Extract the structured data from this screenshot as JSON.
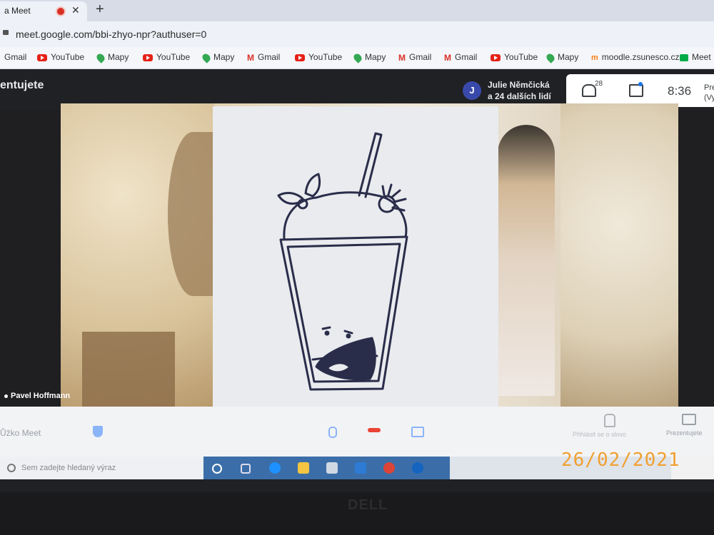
{
  "browser": {
    "tab_title": "a Meet",
    "tab_close": "✕",
    "new_tab": "+",
    "url": "meet.google.com/bbi-zhyo-npr?authuser=0"
  },
  "bookmarks": [
    {
      "label": "Gmail",
      "icon": "gmail-icon"
    },
    {
      "label": "YouTube",
      "icon": "youtube-icon"
    },
    {
      "label": "Mapy",
      "icon": "maps-icon"
    },
    {
      "label": "YouTube",
      "icon": "youtube-icon"
    },
    {
      "label": "Mapy",
      "icon": "maps-icon"
    },
    {
      "label": "Gmail",
      "icon": "gmail-icon"
    },
    {
      "label": "YouTube",
      "icon": "youtube-icon"
    },
    {
      "label": "Mapy",
      "icon": "maps-icon"
    },
    {
      "label": "Gmail",
      "icon": "gmail-icon"
    },
    {
      "label": "Gmail",
      "icon": "gmail-icon"
    },
    {
      "label": "YouTube",
      "icon": "youtube-icon"
    },
    {
      "label": "Mapy",
      "icon": "maps-icon"
    },
    {
      "label": "moodle.zsunesco.cz",
      "icon": "moodle-icon"
    },
    {
      "label": "Meet",
      "icon": "meet-icon"
    }
  ],
  "meet": {
    "presenting_title": "entujete",
    "presenter_initial": "J",
    "presenter_name": "Julie Němčická",
    "presenter_more": "a 24 dalších lidí",
    "participants_count": "28",
    "clock": "8:36",
    "side_label_1": "Pre",
    "side_label_2": "(Vy",
    "tile_name": "Pavel Hoffmann",
    "meeting_details": "Ůžko Meet",
    "raise_hand": "Přihlásit se o slovo",
    "present_now": "Prezentujete"
  },
  "taskbar": {
    "search_placeholder": "Sem zadejte hledaný výraz"
  },
  "photo": {
    "date_stamp": "26/02/2021",
    "bezel_logo": "DELL"
  },
  "colors": {
    "accent_blue": "#1a73e8",
    "end_call_red": "#ea4335",
    "stamp_orange": "#f0a030"
  }
}
